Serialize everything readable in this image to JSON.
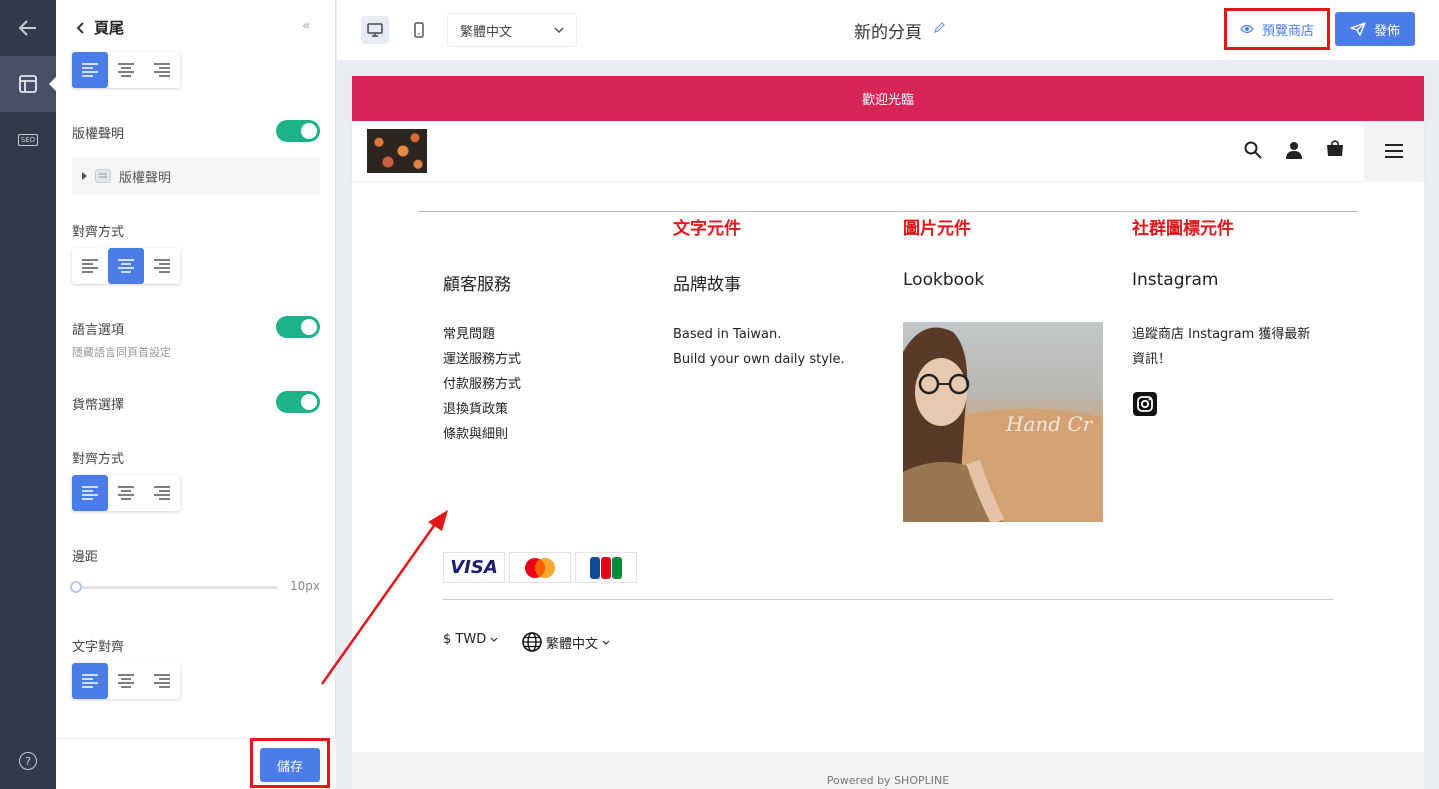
{
  "rail": {
    "back_icon": "arrow-left-icon",
    "layout_icon": "layout-icon",
    "seo_label": "SEO",
    "help_label": "?"
  },
  "panel": {
    "title": "頁尾",
    "collapse_glyph": "«",
    "copyright_label": "版權聲明",
    "copyright_item": "版權聲明",
    "align_label_1": "對齊方式",
    "language_label": "語言選項",
    "language_hint": "隱藏語言同頁首設定",
    "currency_label": "貨幣選擇",
    "align_label_2": "對齊方式",
    "margin_label": "邊距",
    "margin_value": "10px",
    "margin_level": 0,
    "text_align_label": "文字對齊",
    "save_label": "儲存"
  },
  "topbar": {
    "language": "繁體中文",
    "page_title": "新的分頁",
    "preview_label": "預覽商店",
    "publish_label": "發佈"
  },
  "store": {
    "announcement": "歡迎光臨",
    "annotations": [
      "文字元件",
      "圖片元件",
      "社群圖標元件"
    ],
    "columns": [
      {
        "title": "顧客服務",
        "lines": [
          "常見問題",
          "運送服務方式",
          "付款服務方式",
          "退換貨政策",
          "條款與細則"
        ]
      },
      {
        "title": "品牌故事",
        "lines": [
          "Based in Taiwan.",
          "Build your own daily style."
        ]
      },
      {
        "title": "Lookbook",
        "image_text": "Hand Cr"
      },
      {
        "title": "Instagram",
        "lines": [
          "追蹤商店 Instagram 獲得最新",
          "資訊！"
        ]
      }
    ],
    "payments": [
      "VISA",
      "mastercard",
      "JCB"
    ],
    "currency": "$ TWD",
    "footer_language": "繁體中文",
    "powered": "Powered by SHOPLINE"
  },
  "colors": {
    "accent": "#4a7de8",
    "announcement_bg": "#d72558",
    "toggle_on": "#1cb28a",
    "highlight": "#e5161a"
  }
}
